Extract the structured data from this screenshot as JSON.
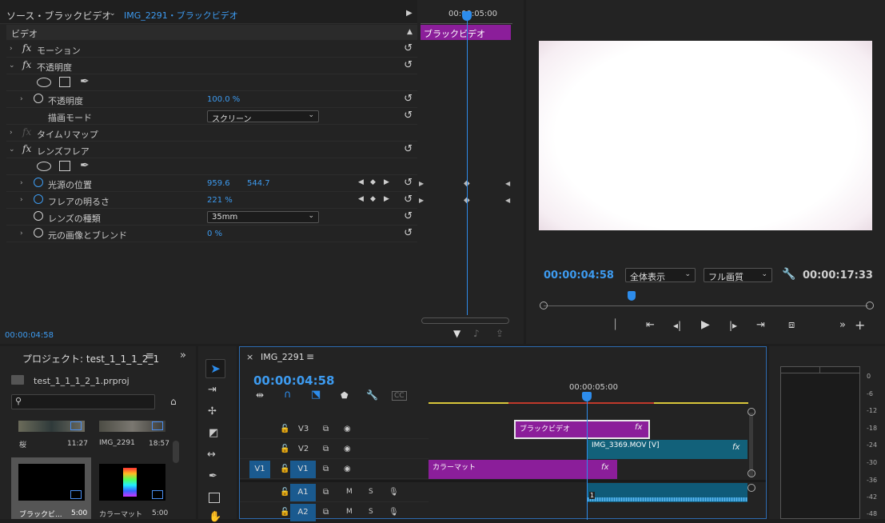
{
  "effects_panel": {
    "tab_source": "ソース・ブラックビデオ",
    "tab_clip": "IMG_2291・ブラックビデオ",
    "section_video": "ビデオ",
    "motion": "モーション",
    "opacity_group": "不透明度",
    "opacity_label": "不透明度",
    "opacity_value": "100.0 %",
    "blend_mode_label": "描画モード",
    "blend_mode_value": "スクリーン",
    "time_remap": "タイムリマップ",
    "lens_flare": "レンズフレア",
    "flare_center_label": "光源の位置",
    "flare_center_x": "959.6",
    "flare_center_y": "544.7",
    "flare_brightness_label": "フレアの明るさ",
    "flare_brightness_value": "221 %",
    "lens_type_label": "レンズの種類",
    "lens_type_value": "35mm",
    "blend_original_label": "元の画像とブレンド",
    "blend_original_value": "0 %",
    "timecode": "00:00:04:58",
    "mini_timeline_time": "00:00:05:00",
    "mini_clip_label": "ブラックビデオ"
  },
  "program_monitor": {
    "current_time": "00:00:04:58",
    "zoom_value": "全体表示",
    "quality_value": "フル画質",
    "duration": "00:00:17:33"
  },
  "project_panel": {
    "title": "プロジェクト: test_1_1_1_2_1",
    "file_name": "test_1_1_1_2_1.prproj",
    "search_placeholder": "",
    "items": [
      {
        "name": "桜",
        "duration": "11:27"
      },
      {
        "name": "IMG_2291",
        "duration": "18:57"
      },
      {
        "name": "ブラックビ...",
        "duration": "5:00"
      },
      {
        "name": "カラーマット",
        "duration": "5:00"
      }
    ]
  },
  "timeline": {
    "sequence_name": "IMG_2291",
    "timecode": "00:00:04:58",
    "ruler_time": "00:00:05:00",
    "tracks": {
      "v3": "V3",
      "v2": "V2",
      "v1": "V1",
      "v1_source": "V1",
      "a1": "A1",
      "a2": "A2",
      "a1_mute": "M",
      "a1_solo": "S",
      "a2_mute": "M",
      "a2_solo": "S"
    },
    "clips": {
      "black_video": "ブラックビデオ",
      "img3369": "IMG_3369.MOV [V]",
      "color_matte": "カラーマット",
      "audio_marker": "1",
      "fx": "fx"
    }
  },
  "meter_labels": [
    "0",
    "-6",
    "-12",
    "-18",
    "-24",
    "-30",
    "-36",
    "-42",
    "-48"
  ],
  "colors": {
    "accent": "#2d8ceb",
    "clip_purple": "#8b1e9a",
    "clip_teal": "#12617a",
    "panel": "#232323"
  }
}
